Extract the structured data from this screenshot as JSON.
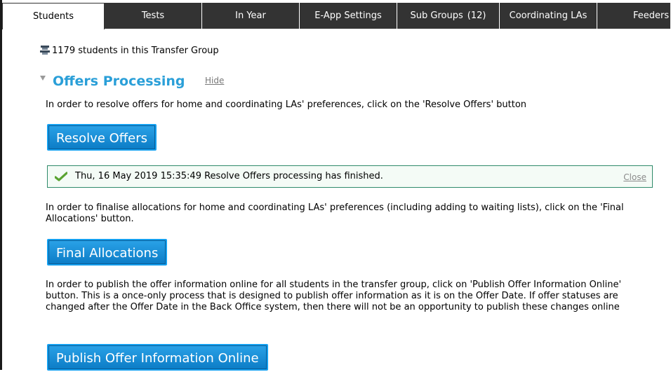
{
  "tabs": [
    {
      "label": "Students",
      "active": true
    },
    {
      "label": "Tests"
    },
    {
      "label": "In Year"
    },
    {
      "label": "E-App Settings"
    },
    {
      "label": "Sub Groups",
      "count": "(12)"
    },
    {
      "label": "Coordinating LAs"
    },
    {
      "label": "Feeders"
    }
  ],
  "students_summary": "1179 students in this Transfer Group",
  "section": {
    "title": "Offers Processing",
    "hide_label": "Hide"
  },
  "resolve": {
    "instruction": "In order to resolve offers for home and coordinating LAs' preferences, click on the 'Resolve Offers' button",
    "button_label": "Resolve Offers"
  },
  "status": {
    "message": "Thu, 16 May 2019 15:35:49 Resolve Offers processing has finished.",
    "close_label": "Close"
  },
  "final": {
    "instruction": "In order to finalise allocations for home and coordinating LAs' preferences (including adding to waiting lists), click on the 'Final Allocations' button.",
    "button_label": "Final Allocations"
  },
  "publish": {
    "instruction": "In order to publish the offer information online for all students in the transfer group, click on 'Publish Offer Information Online' button.  This is a once-only process that is designed to publish offer information as it is on the Offer Date.  If offer statuses are changed after the Offer Date in the Back Office system, then there will not be an opportunity to publish these changes online",
    "button_label": "Publish Offer Information Online"
  },
  "colors": {
    "tab_bg": "#333333",
    "title_blue": "#2a9fd8",
    "button_blue": "#1a8fd8",
    "status_border": "#2f8a6a",
    "check_green": "#5aa332"
  }
}
